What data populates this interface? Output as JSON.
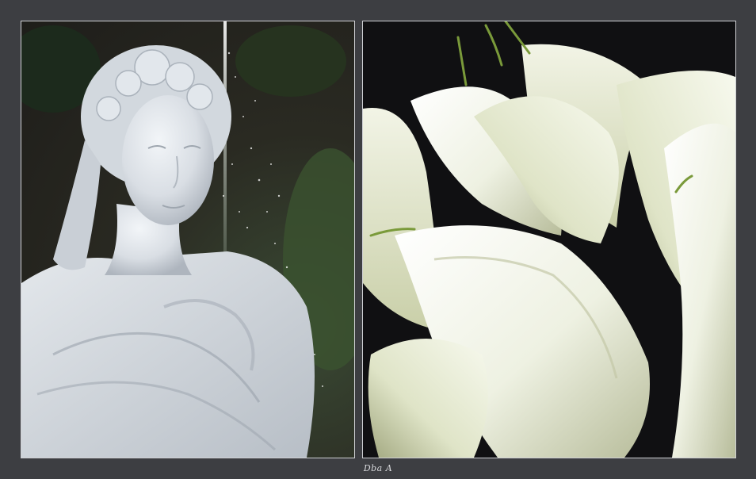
{
  "caption": "Dba A",
  "colors": {
    "background": "#3d3e42",
    "panel_border": "#cfd0d4",
    "marble": "#e6eaee",
    "lily_white": "#eef1e0",
    "lily_stem": "#7a9a3a"
  },
  "images": {
    "left": "marble-bust-with-fountain",
    "right": "white-calla-lilies"
  }
}
